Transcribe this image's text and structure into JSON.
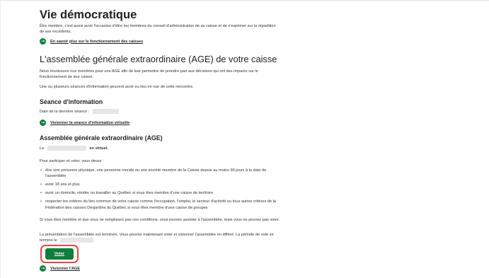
{
  "page": {
    "title": "Vie démocratique",
    "intro": "Être membre, c'est aussi avoir l'occasion d'élire les membres du conseil d'administration de sa caisse et de s'exprimer sur la répartition de ses excédents.",
    "link_functioning": "En savoir plus sur le fonctionnement des caisses"
  },
  "age": {
    "heading": "L'assemblée générale extraordinaire (AGE) de votre caisse",
    "p1": "Nous réunissons nos membres pour une AGE afin de leur permettre de prendre part aux décisions qui ont des impacts sur le fonctionnement de leur caisse.",
    "p2": "Une ou plusieurs séances d'information peuvent avoir eu lieu en vue de cette rencontre."
  },
  "seance": {
    "heading": "Séance d'information",
    "last_date_label": "Date de la dernière séance :",
    "link_video": "Visionner la séance d'information virtuelle"
  },
  "assembly": {
    "heading": "Assemblée générale extraordinaire (AGE)",
    "le_prefix": "Le",
    "le_suffix": "en virtuel.",
    "eligibility_intro": "Pour participer et voter, vous devez :",
    "criteria": [
      "être une personne physique, une personne morale ou une société membre de la Caisse depuis au moins 90 jours à la date de l'assemblée",
      "avoir 18 ans et plus",
      "avoir un domicile, résider ou travailler au Québec si vous êtes membre d'une caisse de territoire",
      "respecter les critères du lien commun de votre caisse comme l'occupation, l'emploi, le secteur d'activité ou tous autres critères de la Fédération des caisses Desjardins du Québec si vous êtes membre d'une caisse de groupes"
    ],
    "not_eligible": "Si vous êtes membre et que vous ne remplissez pas ces conditions, vous pouvez assister à l'assemblée, mais vous ne pouvez pas voter.",
    "finished": "La présentation de l'assemblée est terminée. Vous pouvez maintenant voter et visionner l'assemblée en différé. La période de vote se termine le",
    "vote_label": "Voter",
    "link_watch": "Visionner l'AGE"
  },
  "colors": {
    "accent_green": "#0c7f3d",
    "highlight_red": "#e54a3c",
    "redaction_gray": "#e6e6e6"
  },
  "icons": {
    "link_arrow": "arrow-right-circle-icon"
  }
}
